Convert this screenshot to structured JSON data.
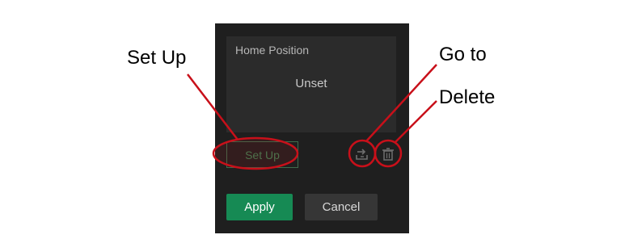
{
  "panel": {
    "home_position_title": "Home Position",
    "home_position_value": "Unset",
    "setup_label": "Set Up",
    "goto_icon": "goto-icon",
    "delete_icon": "trash-icon",
    "apply_label": "Apply",
    "cancel_label": "Cancel"
  },
  "annotations": {
    "setup": "Set Up",
    "goto": "Go to",
    "delete": "Delete"
  },
  "colors": {
    "panel_bg": "#1f1f1f",
    "box_bg": "#2b2b2b",
    "accent_green": "#168a54",
    "annotation_red": "#c8101a"
  }
}
